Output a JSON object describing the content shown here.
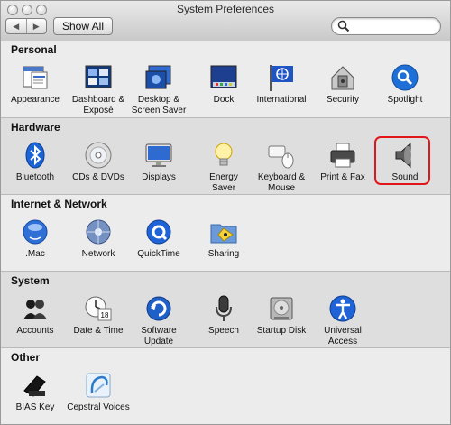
{
  "window": {
    "title": "System Preferences",
    "show_all": "Show All",
    "nav_back": "◀",
    "nav_forward": "▶",
    "search": {
      "value": "",
      "placeholder": ""
    }
  },
  "sections": [
    {
      "title": "Personal",
      "items": [
        {
          "line1": "Appearance",
          "line2": "",
          "icon": "appearance-icon"
        },
        {
          "line1": "Dashboard &",
          "line2": "Exposé",
          "icon": "dashboard-expose-icon"
        },
        {
          "line1": "Desktop &",
          "line2": "Screen Saver",
          "icon": "desktop-screensaver-icon"
        },
        {
          "line1": "Dock",
          "line2": "",
          "icon": "dock-icon"
        },
        {
          "line1": "International",
          "line2": "",
          "icon": "international-icon"
        },
        {
          "line1": "Security",
          "line2": "",
          "icon": "security-icon"
        },
        {
          "line1": "Spotlight",
          "line2": "",
          "icon": "spotlight-icon"
        }
      ]
    },
    {
      "title": "Hardware",
      "items": [
        {
          "line1": "Bluetooth",
          "line2": "",
          "icon": "bluetooth-icon"
        },
        {
          "line1": "CDs & DVDs",
          "line2": "",
          "icon": "cds-dvds-icon"
        },
        {
          "line1": "Displays",
          "line2": "",
          "icon": "displays-icon"
        },
        {
          "line1": "Energy",
          "line2": "Saver",
          "icon": "energy-saver-icon"
        },
        {
          "line1": "Keyboard &",
          "line2": "Mouse",
          "icon": "keyboard-mouse-icon"
        },
        {
          "line1": "Print & Fax",
          "line2": "",
          "icon": "print-fax-icon"
        },
        {
          "line1": "Sound",
          "line2": "",
          "icon": "sound-icon",
          "highlighted": true
        }
      ]
    },
    {
      "title": "Internet & Network",
      "items": [
        {
          "line1": ".Mac",
          "line2": "",
          "icon": "dotmac-icon"
        },
        {
          "line1": "Network",
          "line2": "",
          "icon": "network-icon"
        },
        {
          "line1": "QuickTime",
          "line2": "",
          "icon": "quicktime-icon"
        },
        {
          "line1": "Sharing",
          "line2": "",
          "icon": "sharing-icon"
        }
      ]
    },
    {
      "title": "System",
      "items": [
        {
          "line1": "Accounts",
          "line2": "",
          "icon": "accounts-icon"
        },
        {
          "line1": "Date & Time",
          "line2": "",
          "icon": "date-time-icon"
        },
        {
          "line1": "Software",
          "line2": "Update",
          "icon": "software-update-icon"
        },
        {
          "line1": "Speech",
          "line2": "",
          "icon": "speech-icon"
        },
        {
          "line1": "Startup Disk",
          "line2": "",
          "icon": "startup-disk-icon"
        },
        {
          "line1": "Universal",
          "line2": "Access",
          "icon": "universal-access-icon"
        }
      ]
    },
    {
      "title": "Other",
      "items": [
        {
          "line1": "BIAS Key",
          "line2": "",
          "icon": "bias-key-icon"
        },
        {
          "line1": "Cepstral Voices",
          "line2": "",
          "icon": "cepstral-voices-icon"
        }
      ]
    }
  ],
  "colors": {
    "highlight": "#e0161b",
    "spotlight_blue": "#1f6fd8",
    "bluetooth_blue": "#1a64d6"
  }
}
